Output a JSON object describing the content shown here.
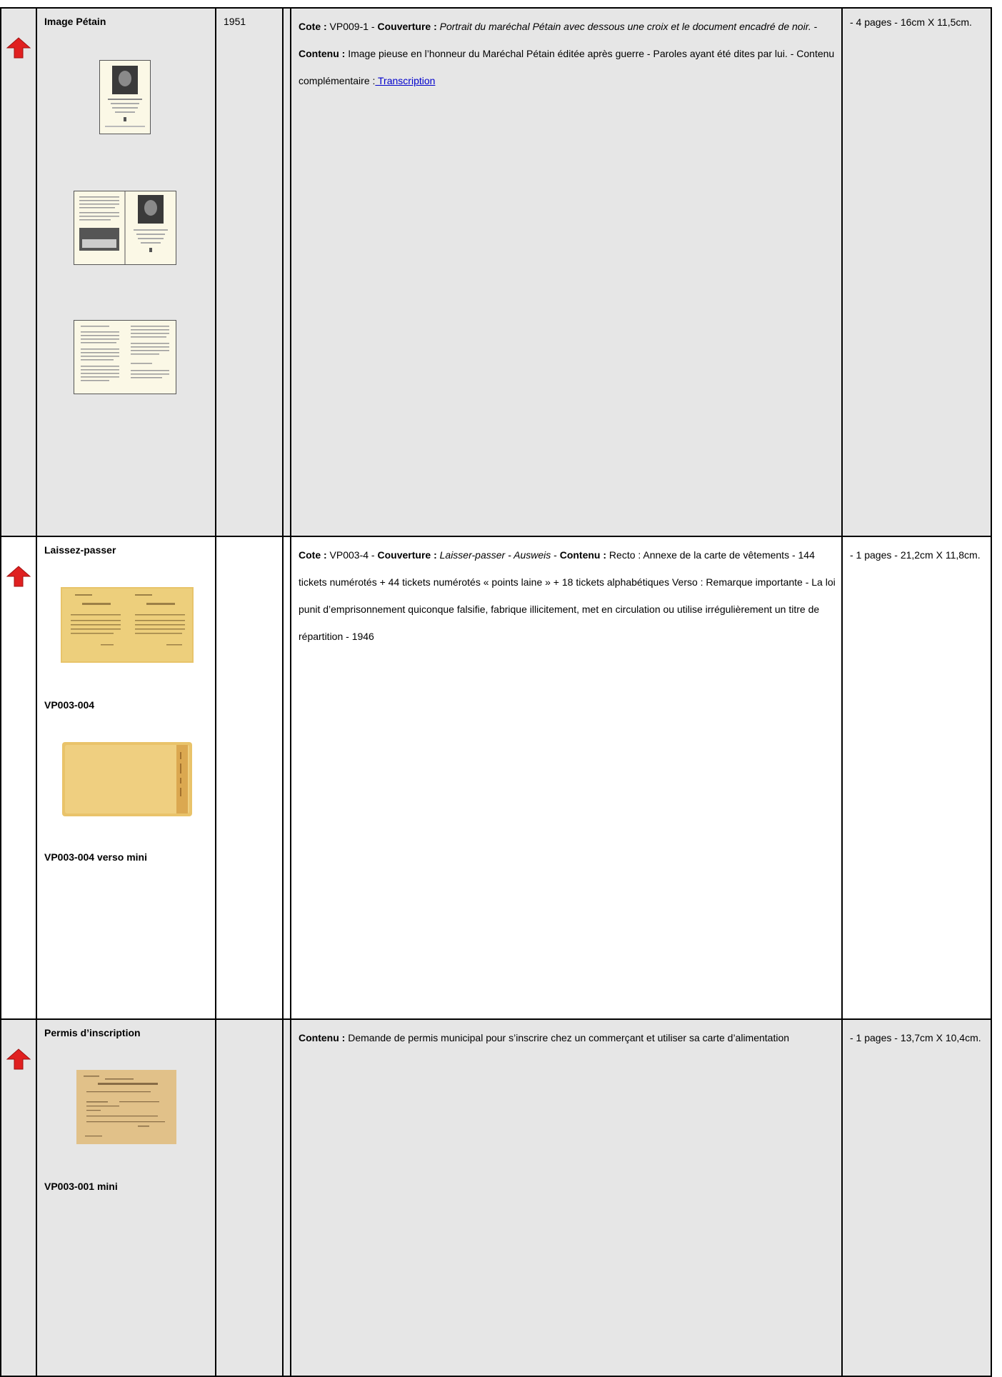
{
  "rows": [
    {
      "title": "Image Pétain",
      "year": "1951",
      "cote_label": "Cote :",
      "cote_value": " VP009-1 - ",
      "couverture_label": "Couverture :",
      "couverture_text": " Portrait du maréchal Pétain avec dessous une croix et le document encadré de noir.",
      "sep1": " - ",
      "contenu_label": "Contenu :",
      "contenu_text": " Image pieuse en l’honneur du Maréchal Pétain éditée après guerre - Paroles ayant été dites par lui. - Contenu complémentaire :",
      "link_text": " Transcription",
      "dims": " - 4 pages - 16cm X 11,5cm."
    },
    {
      "title": "Laissez-passer",
      "year": "",
      "cote_label": "Cote :",
      "cote_value": " VP003-4 - ",
      "couverture_label": "Couverture :",
      "couverture_text": " Laisser-passer - Ausweis",
      "sep1": " - ",
      "contenu_label": "Contenu :",
      "contenu_text": " Recto : Annexe de la carte de vêtements - 144 tickets numérotés + 44 tickets numérotés « points laine » + 18 tickets alphabétiques Verso : Remarque importante - La loi punit d’emprisonnement quiconque falsifie, fabrique illicitement, met en circulation ou utilise irrégulièrement un titre de répartition - 1946",
      "caption1": "VP003-004",
      "caption2": "VP003-004 verso mini",
      "dims": " - 1 pages - 21,2cm X 11,8cm."
    },
    {
      "title": "Permis d’inscription",
      "year": "",
      "contenu_label": "Contenu :",
      "contenu_text": " Demande de permis municipal pour s’inscrire chez un commerçant et utiliser sa carte d’alimentation",
      "caption1": "VP003-001 mini",
      "dims": " - 1 pages - 13,7cm X 10,4cm."
    }
  ],
  "icons": {
    "back_to_top": "red-up-arrow-icon"
  },
  "colors": {
    "row_gray": "#e6e6e6",
    "row_white": "#ffffff",
    "link": "#0000cc",
    "arrow": "#e02020"
  }
}
